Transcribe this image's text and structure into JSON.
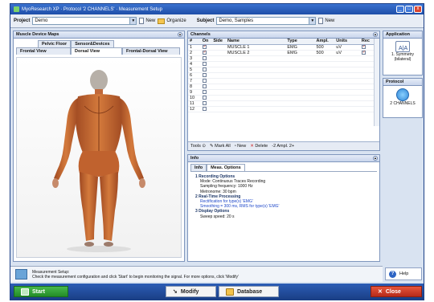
{
  "window": {
    "title": "MyoResearch XP · Protocol '2 CHANNELS' · Measurement Setup",
    "controls": [
      "_",
      "□",
      "x"
    ]
  },
  "project_bar": {
    "project_label": "Project",
    "project_value": "Demo",
    "new_label": "New",
    "organize_label": "Organize",
    "subject_label": "Subject",
    "subject_value": "Demo, Samples",
    "subject_new_label": "New"
  },
  "muscle_maps": {
    "title": "Muscle Device Maps",
    "tabs_row1": [
      "Pelvic Floor",
      "Sensor&Devices"
    ],
    "tabs_row2": [
      "Frontal View",
      "Dorsal View",
      "Frontal-Dorsal View"
    ],
    "active_tab": "Dorsal View"
  },
  "channels": {
    "title": "Channels",
    "columns": [
      "#",
      "On",
      "Side",
      "Name",
      "Type",
      "Ampl.",
      "Units",
      "Rec"
    ],
    "rows": [
      {
        "num": "1",
        "on": true,
        "name": "MUSCLE 1",
        "type": "EMG",
        "ampl": "500",
        "units": "uV",
        "rec": true
      },
      {
        "num": "2",
        "on": true,
        "name": "MUSCLE 2",
        "type": "EMG",
        "ampl": "500",
        "units": "uV",
        "rec": true
      },
      {
        "num": "3",
        "on": false,
        "name": "",
        "type": "",
        "ampl": "",
        "units": "",
        "rec": false
      },
      {
        "num": "4",
        "on": false,
        "name": "",
        "type": "",
        "ampl": "",
        "units": "",
        "rec": false
      },
      {
        "num": "5",
        "on": false,
        "name": "",
        "type": "",
        "ampl": "",
        "units": "",
        "rec": false
      },
      {
        "num": "6",
        "on": false,
        "name": "",
        "type": "",
        "ampl": "",
        "units": "",
        "rec": false
      },
      {
        "num": "7",
        "on": false,
        "name": "",
        "type": "",
        "ampl": "",
        "units": "",
        "rec": false
      },
      {
        "num": "8",
        "on": false,
        "name": "",
        "type": "",
        "ampl": "",
        "units": "",
        "rec": false
      },
      {
        "num": "9",
        "on": false,
        "name": "",
        "type": "",
        "ampl": "",
        "units": "",
        "rec": false
      },
      {
        "num": "10",
        "on": false,
        "name": "",
        "type": "",
        "ampl": "",
        "units": "",
        "rec": false
      },
      {
        "num": "11",
        "on": false,
        "name": "",
        "type": "",
        "ampl": "",
        "units": "",
        "rec": false
      },
      {
        "num": "12",
        "on": false,
        "name": "",
        "type": "",
        "ampl": "",
        "units": "",
        "rec": false
      }
    ],
    "tools_label": "Tools",
    "mark_all_label": "Mark All",
    "new_label": "New",
    "delete_label": "Delete",
    "ampl_label": "-2 Ampl. 2+"
  },
  "info": {
    "title": "Info",
    "tabs": [
      "Info",
      "Meas. Options"
    ],
    "active_tab": "Meas. Options",
    "sections": [
      {
        "heading": "1 Recording Options",
        "lines": [
          "Mode: Continuous Traces Recording",
          "Sampling frequency: 1000 Hz",
          "Metronome: 30 bpm"
        ],
        "blue": false
      },
      {
        "heading": "2 Real-Time Processing",
        "lines": [
          "Rectification for type(s) 'EMG'",
          "Smoothing = 300 ms, RMS for type(s) 'EMG'"
        ],
        "blue": true
      },
      {
        "heading": "3 Display Options",
        "lines": [
          "Sweep speed: 20 s"
        ],
        "blue": false
      }
    ]
  },
  "sidebar": {
    "application_title": "Application",
    "application_item": "1. Symmetry (bilateral)",
    "protocol_title": "Protocol",
    "protocol_item": "2 CHANNELS"
  },
  "status": {
    "title": "Measurement Setup:",
    "text": "Check the measurement configuration and click 'Start' to begin monitoring the signal. For more options, click 'Modify'"
  },
  "help": {
    "label": "Help"
  },
  "bottom": {
    "start_label": "Start",
    "modify_label": "Modify",
    "database_label": "Database",
    "close_label": "Close"
  }
}
